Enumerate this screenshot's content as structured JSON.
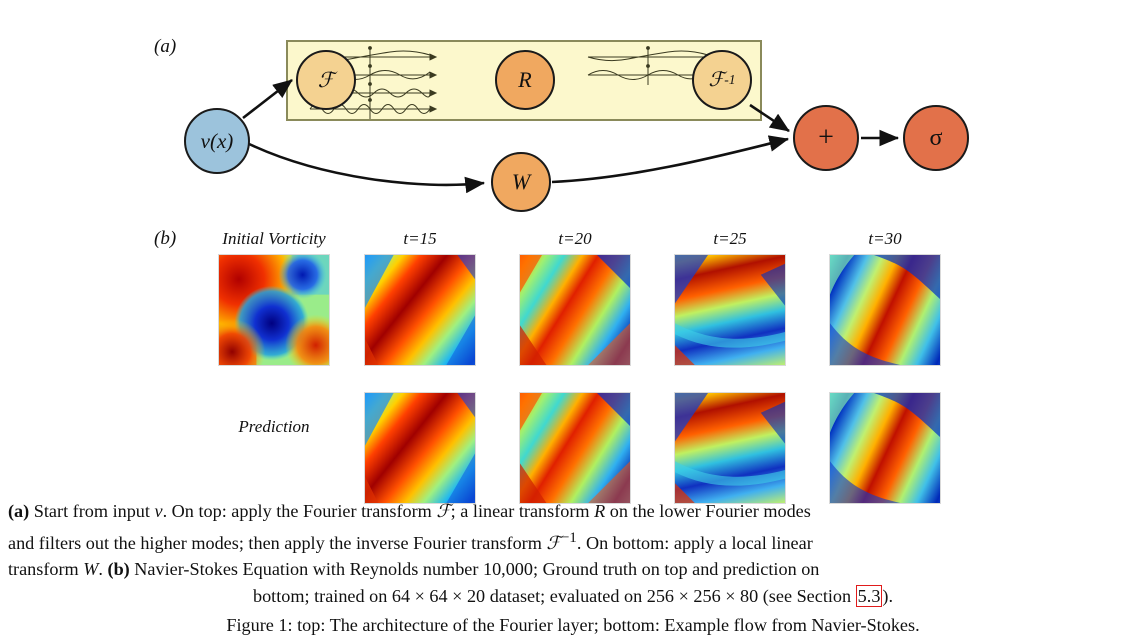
{
  "figure": {
    "panel_a_label": "(a)",
    "panel_b_label": "(b)"
  },
  "diagram": {
    "nodes": [
      {
        "id": "input",
        "label": "v(x)",
        "color": "#9cc3dc"
      },
      {
        "id": "fourier",
        "label": "ℱ",
        "color": "#f4d291"
      },
      {
        "id": "linear",
        "label": "R",
        "color": "#f0a860"
      },
      {
        "id": "inverse",
        "label": "ℱ",
        "sup": "-1",
        "color": "#f4d291"
      },
      {
        "id": "local",
        "label": "W",
        "color": "#f0a860"
      },
      {
        "id": "add",
        "label": "+",
        "color": "#e2714a"
      },
      {
        "id": "sigma",
        "label": "σ",
        "color": "#e2714a"
      }
    ],
    "fourier_box_color": "#fcf8cc",
    "fourier_box_border": "#8a8a5a"
  },
  "flow": {
    "column_titles": [
      "Initial Vorticity",
      "t=15",
      "t=20",
      "t=25",
      "t=30"
    ],
    "row_titles": [
      "",
      "Prediction"
    ]
  },
  "caption": {
    "line1_pre": "(a)",
    "line1": " Start from input ",
    "line1_v": "v",
    "line1_b": ". On top: apply the Fourier transform ",
    "line1_F": "ℱ",
    "line1_c": "; a linear transform ",
    "line1_R": "R",
    "line1_d": " on the lower Fourier modes",
    "line2_a": "and filters out the higher modes; then apply the inverse Fourier transform ",
    "line2_F": "ℱ",
    "line2_sup": "−1",
    "line2_b": ". On bottom: apply a local linear",
    "line3_a": "transform ",
    "line3_W": "W",
    "line3_b": ". ",
    "line3_bold": "(b)",
    "line3_c": " Navier-Stokes Equation with Reynolds number 10,000; Ground truth on top and prediction on",
    "line4_a": "bottom; trained on 64 × 64 × 20 dataset; evaluated on 256 × 256 × 80 (see Section ",
    "line4_ref": "5.3",
    "line4_b": ")."
  },
  "footer": {
    "clipped_line": "Figure 1:  top:  The architecture of the Fourier layer;  bottom:  Example flow from Navier-Stokes."
  },
  "chart_data": {
    "type": "heatmap",
    "title": "Navier-Stokes vorticity evolution",
    "colormap": "jet",
    "columns": [
      "Initial Vorticity",
      "t=15",
      "t=20",
      "t=25",
      "t=30"
    ],
    "rows": [
      "Ground truth",
      "Prediction"
    ],
    "reynolds_number": "10,000",
    "train_resolution": "64 x 64 x 20",
    "eval_resolution": "256 x 256 x 80"
  }
}
